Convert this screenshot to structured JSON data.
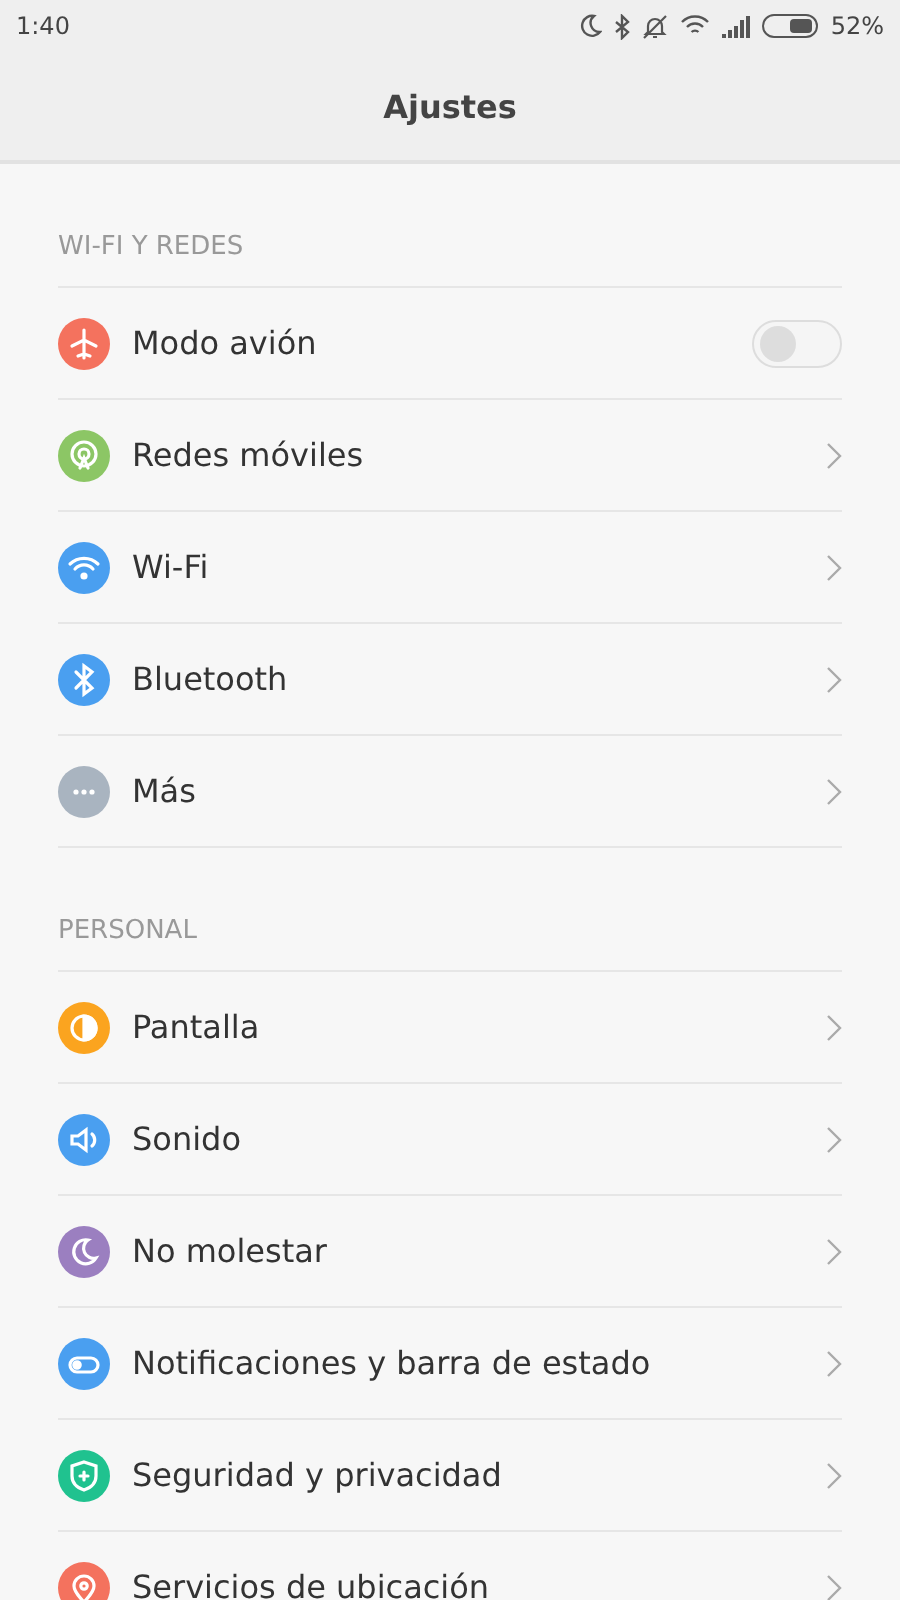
{
  "status_bar": {
    "time": "1:40",
    "battery_percent": "52%"
  },
  "title": "Ajustes",
  "sections": [
    {
      "header": "WI-FI Y REDES",
      "items": [
        {
          "label": "Modo avión",
          "kind": "toggle",
          "on": false,
          "color": "#f4725e"
        },
        {
          "label": "Redes móviles",
          "kind": "link",
          "color": "#8cc665"
        },
        {
          "label": "Wi-Fi",
          "kind": "link",
          "color": "#4a9ff0"
        },
        {
          "label": "Bluetooth",
          "kind": "link",
          "color": "#4a9ff0"
        },
        {
          "label": "Más",
          "kind": "link",
          "color": "#a9b4c0"
        }
      ]
    },
    {
      "header": "PERSONAL",
      "items": [
        {
          "label": "Pantalla",
          "kind": "link",
          "color": "#fba41f"
        },
        {
          "label": "Sonido",
          "kind": "link",
          "color": "#4a9ff0"
        },
        {
          "label": "No molestar",
          "kind": "link",
          "color": "#9b7fc0"
        },
        {
          "label": "Notificaciones y barra de estado",
          "kind": "link",
          "color": "#4a9ff0"
        },
        {
          "label": "Seguridad y privacidad",
          "kind": "link",
          "color": "#20c28f"
        },
        {
          "label": "Servicios de ubicación",
          "kind": "link",
          "color": "#f4725e"
        }
      ]
    }
  ]
}
